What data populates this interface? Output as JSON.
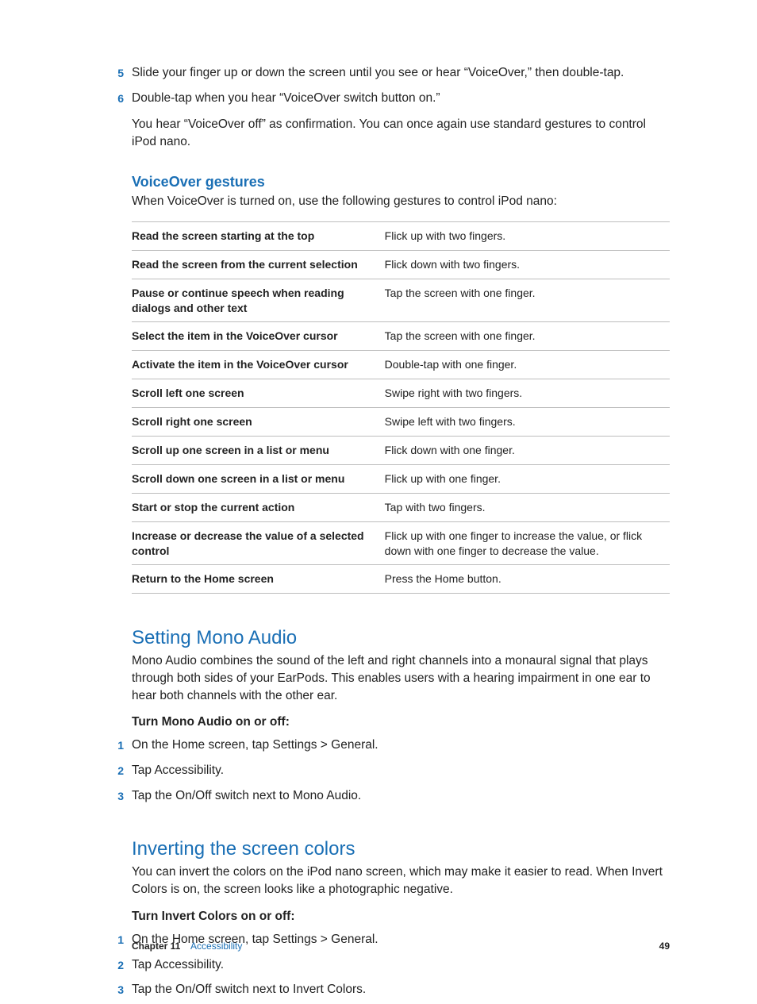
{
  "topSteps": [
    {
      "n": "5",
      "t": "Slide your finger up or down the screen until you see or hear “VoiceOver,” then double-tap."
    },
    {
      "n": "6",
      "t": "Double-tap when you hear “VoiceOver switch button on.”"
    }
  ],
  "afterNote": "You hear “VoiceOver off” as confirmation. You can once again use standard gestures to control iPod nano.",
  "gestures": {
    "heading": "VoiceOver gestures",
    "intro": "When VoiceOver is turned on, use the following gestures to control iPod nano:",
    "rows": [
      {
        "k": "Read the screen starting at the top",
        "v": "Flick up with two fingers."
      },
      {
        "k": "Read the screen from the current selection",
        "v": "Flick down with two fingers."
      },
      {
        "k": "Pause or continue speech when reading dialogs and other text",
        "v": "Tap the screen with one finger."
      },
      {
        "k": "Select the item in the VoiceOver cursor",
        "v": "Tap the screen with one finger."
      },
      {
        "k": "Activate the item in the VoiceOver cursor",
        "v": "Double-tap with one finger."
      },
      {
        "k": "Scroll left one screen",
        "v": "Swipe right with two fingers."
      },
      {
        "k": "Scroll right one screen",
        "v": "Swipe left with two fingers."
      },
      {
        "k": "Scroll up one screen in a list or menu",
        "v": "Flick down with one finger."
      },
      {
        "k": "Scroll down one screen in a list or menu",
        "v": "Flick up with one finger."
      },
      {
        "k": "Start or stop the current action",
        "v": "Tap with two fingers."
      },
      {
        "k": "Increase or decrease the value of a selected control",
        "v": "Flick up with one finger to increase the value, or flick down with one finger to decrease the value."
      },
      {
        "k": "Return to the Home screen",
        "v": "Press the Home button."
      }
    ]
  },
  "mono": {
    "heading": "Setting Mono Audio",
    "body": "Mono Audio combines the sound of the left and right channels into a monaural signal that plays through both sides of your EarPods. This enables users with a hearing impairment in one ear to hear both channels with the other ear.",
    "subhead": "Turn Mono Audio on or off:",
    "steps": [
      {
        "n": "1",
        "t": "On the Home screen, tap Settings > General."
      },
      {
        "n": "2",
        "t": "Tap Accessibility."
      },
      {
        "n": "3",
        "t": "Tap the On/Off switch next to Mono Audio."
      }
    ]
  },
  "invert": {
    "heading": "Inverting the screen colors",
    "body": "You can invert the colors on the iPod nano screen, which may make it easier to read. When Invert Colors is on, the screen looks like a photographic negative.",
    "subhead": "Turn Invert Colors on or off:",
    "steps": [
      {
        "n": "1",
        "t": "On the Home screen, tap Settings > General."
      },
      {
        "n": "2",
        "t": "Tap Accessibility."
      },
      {
        "n": "3",
        "t": "Tap the On/Off switch next to Invert Colors."
      }
    ]
  },
  "footer": {
    "chapter": "Chapter  11",
    "name": "Accessibility",
    "page": "49"
  }
}
